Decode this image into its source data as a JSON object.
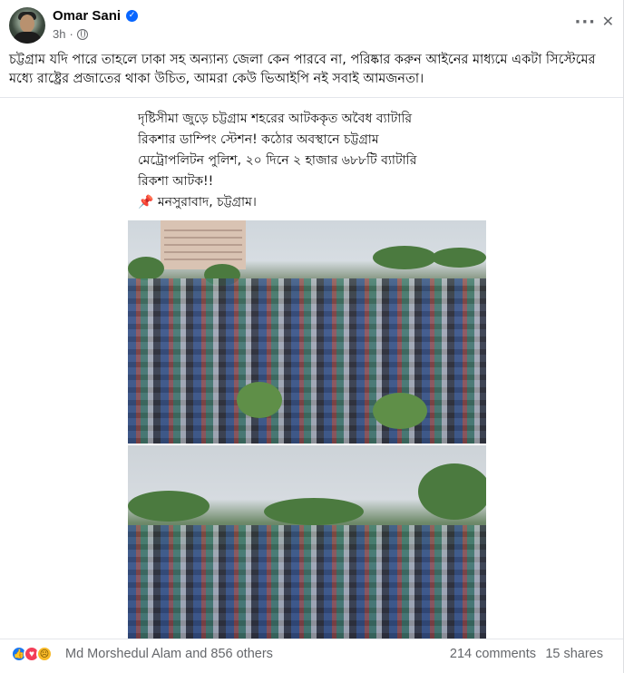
{
  "post": {
    "author": "Omar Sani",
    "time": "3h",
    "text": "চট্টগ্রাম যদি পারে তাহলে ঢাকা সহ অন্যান্য জেলা কেন পারবে না, পরিষ্কার করুন আইনের মাধ্যমে একটা সিস্টেমের মধ্যে রাষ্ট্রের প্রজাতের থাকা উচিত, আমরা কেউ ভিআইপি নই সবাই আমজনতা।",
    "icons": {
      "verified": "verified-badge-icon",
      "privacy": "globe-icon",
      "more": "more-options-icon",
      "close": "close-icon"
    }
  },
  "image_card": {
    "caption_lines": [
      "দৃষ্টিসীমা জুড়ে চট্টগ্রাম শহরের আটককৃত অবৈধ ব্যাটারি",
      "রিকশার ডাম্পিং স্টেশন! কঠোর অবস্থানে চট্টগ্রাম",
      "মেট্রোপলিটন পুলিশ, ২০ দিনে ২ হাজার ৬৮৮টি ব্যাটারি",
      "রিকশা আটক!!"
    ],
    "location_pin": "📌",
    "location": "মনসুরাবাদ, চট্টগ্রাম।"
  },
  "footer": {
    "reaction_text": "Md Morshedul Alam and 856 others",
    "comments": "214 comments",
    "shares": "15 shares",
    "reaction_icons": [
      "like-icon",
      "love-icon",
      "care-icon"
    ]
  },
  "colors": {
    "accent": "#0866ff",
    "secondary_text": "#65676b",
    "like": "#1877f2",
    "love": "#f33e58",
    "care": "#f7b928"
  }
}
